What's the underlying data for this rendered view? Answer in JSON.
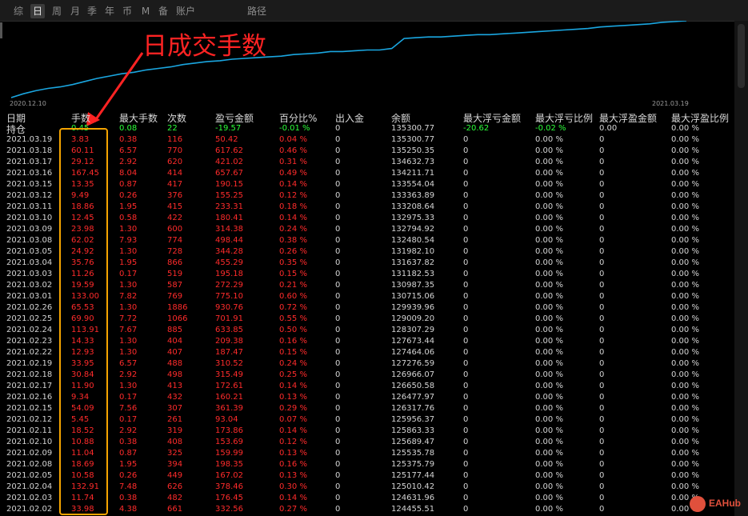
{
  "toolbar": {
    "tabs": [
      {
        "label": "综",
        "active": false
      },
      {
        "label": "日",
        "active": true
      },
      {
        "label": "周",
        "active": false
      },
      {
        "label": "月",
        "active": false
      },
      {
        "label": "季",
        "active": false
      },
      {
        "label": "年",
        "active": false
      },
      {
        "label": "币",
        "active": false
      },
      {
        "label": "M",
        "active": false
      },
      {
        "label": "备",
        "active": false
      },
      {
        "label": "账户",
        "active": false
      },
      {
        "label": "路径",
        "active": false
      }
    ]
  },
  "chart": {
    "start_date": "2020.12.10",
    "end_date": "2021.03.19",
    "line_color": "#1aa6e0"
  },
  "chart_data": {
    "type": "line",
    "x_start": "2020.12.10",
    "x_end": "2021.03.19",
    "series": [
      {
        "values": [
          0.0,
          0.05,
          0.09,
          0.12,
          0.14,
          0.17,
          0.21,
          0.25,
          0.28,
          0.31,
          0.33,
          0.36,
          0.38,
          0.4,
          0.43,
          0.45,
          0.47,
          0.48,
          0.5,
          0.51,
          0.52,
          0.53,
          0.54,
          0.56,
          0.57,
          0.58,
          0.6,
          0.6,
          0.61,
          0.62,
          0.62,
          0.64,
          0.77,
          0.78,
          0.79,
          0.79,
          0.8,
          0.81,
          0.82,
          0.82,
          0.83,
          0.84,
          0.85,
          0.86,
          0.87,
          0.88,
          0.89,
          0.9,
          0.92,
          0.93,
          0.94,
          0.95,
          0.96,
          0.98,
          0.99,
          1.0
        ]
      }
    ],
    "grid": false,
    "legend": "none"
  },
  "annotation": {
    "text": "日成交手数",
    "color": "#ff2323",
    "box_color": "#f5a400"
  },
  "table": {
    "headers": [
      "日期",
      "手数",
      "最大手数",
      "次数",
      "盈亏金额",
      "百分比%",
      "出入金",
      "余额",
      "最大浮亏金额",
      "最大浮亏比例",
      "最大浮盈金额",
      "最大浮盈比例"
    ],
    "holding": [
      "持仓",
      "0.45",
      "0.08",
      "22",
      "-19.57",
      "-0.01 %",
      "0",
      "135300.77",
      "-20.62",
      "-0.02 %",
      "0.00",
      "0.00 %"
    ],
    "rows": [
      [
        "2021.03.19",
        "3.83",
        "0.38",
        "116",
        "50.42",
        "0.04 %",
        "0",
        "135300.77",
        "0",
        "0.00 %",
        "0",
        "0.00 %"
      ],
      [
        "2021.03.18",
        "60.11",
        "6.57",
        "770",
        "617.62",
        "0.46 %",
        "0",
        "135250.35",
        "0",
        "0.00 %",
        "0",
        "0.00 %"
      ],
      [
        "2021.03.17",
        "29.12",
        "2.92",
        "620",
        "421.02",
        "0.31 %",
        "0",
        "134632.73",
        "0",
        "0.00 %",
        "0",
        "0.00 %"
      ],
      [
        "2021.03.16",
        "167.45",
        "8.04",
        "414",
        "657.67",
        "0.49 %",
        "0",
        "134211.71",
        "0",
        "0.00 %",
        "0",
        "0.00 %"
      ],
      [
        "2021.03.15",
        "13.35",
        "0.87",
        "417",
        "190.15",
        "0.14 %",
        "0",
        "133554.04",
        "0",
        "0.00 %",
        "0",
        "0.00 %"
      ],
      [
        "2021.03.12",
        "9.49",
        "0.26",
        "376",
        "155.25",
        "0.12 %",
        "0",
        "133363.89",
        "0",
        "0.00 %",
        "0",
        "0.00 %"
      ],
      [
        "2021.03.11",
        "18.86",
        "1.95",
        "415",
        "233.31",
        "0.18 %",
        "0",
        "133208.64",
        "0",
        "0.00 %",
        "0",
        "0.00 %"
      ],
      [
        "2021.03.10",
        "12.45",
        "0.58",
        "422",
        "180.41",
        "0.14 %",
        "0",
        "132975.33",
        "0",
        "0.00 %",
        "0",
        "0.00 %"
      ],
      [
        "2021.03.09",
        "23.98",
        "1.30",
        "600",
        "314.38",
        "0.24 %",
        "0",
        "132794.92",
        "0",
        "0.00 %",
        "0",
        "0.00 %"
      ],
      [
        "2021.03.08",
        "62.02",
        "7.93",
        "774",
        "498.44",
        "0.38 %",
        "0",
        "132480.54",
        "0",
        "0.00 %",
        "0",
        "0.00 %"
      ],
      [
        "2021.03.05",
        "24.92",
        "1.30",
        "728",
        "344.28",
        "0.26 %",
        "0",
        "131982.10",
        "0",
        "0.00 %",
        "0",
        "0.00 %"
      ],
      [
        "2021.03.04",
        "35.76",
        "1.95",
        "866",
        "455.29",
        "0.35 %",
        "0",
        "131637.82",
        "0",
        "0.00 %",
        "0",
        "0.00 %"
      ],
      [
        "2021.03.03",
        "11.26",
        "0.17",
        "519",
        "195.18",
        "0.15 %",
        "0",
        "131182.53",
        "0",
        "0.00 %",
        "0",
        "0.00 %"
      ],
      [
        "2021.03.02",
        "19.59",
        "1.30",
        "587",
        "272.29",
        "0.21 %",
        "0",
        "130987.35",
        "0",
        "0.00 %",
        "0",
        "0.00 %"
      ],
      [
        "2021.03.01",
        "133.00",
        "7.82",
        "769",
        "775.10",
        "0.60 %",
        "0",
        "130715.06",
        "0",
        "0.00 %",
        "0",
        "0.00 %"
      ],
      [
        "2021.02.26",
        "65.53",
        "1.30",
        "1886",
        "930.76",
        "0.72 %",
        "0",
        "129939.96",
        "0",
        "0.00 %",
        "0",
        "0.00 %"
      ],
      [
        "2021.02.25",
        "69.90",
        "7.72",
        "1066",
        "701.91",
        "0.55 %",
        "0",
        "129009.20",
        "0",
        "0.00 %",
        "0",
        "0.00 %"
      ],
      [
        "2021.02.24",
        "113.91",
        "7.67",
        "885",
        "633.85",
        "0.50 %",
        "0",
        "128307.29",
        "0",
        "0.00 %",
        "0",
        "0.00 %"
      ],
      [
        "2021.02.23",
        "14.33",
        "1.30",
        "404",
        "209.38",
        "0.16 %",
        "0",
        "127673.44",
        "0",
        "0.00 %",
        "0",
        "0.00 %"
      ],
      [
        "2021.02.22",
        "12.93",
        "1.30",
        "407",
        "187.47",
        "0.15 %",
        "0",
        "127464.06",
        "0",
        "0.00 %",
        "0",
        "0.00 %"
      ],
      [
        "2021.02.19",
        "33.95",
        "6.57",
        "488",
        "310.52",
        "0.24 %",
        "0",
        "127276.59",
        "0",
        "0.00 %",
        "0",
        "0.00 %"
      ],
      [
        "2021.02.18",
        "30.84",
        "2.92",
        "498",
        "315.49",
        "0.25 %",
        "0",
        "126966.07",
        "0",
        "0.00 %",
        "0",
        "0.00 %"
      ],
      [
        "2021.02.17",
        "11.90",
        "1.30",
        "413",
        "172.61",
        "0.14 %",
        "0",
        "126650.58",
        "0",
        "0.00 %",
        "0",
        "0.00 %"
      ],
      [
        "2021.02.16",
        "9.34",
        "0.17",
        "432",
        "160.21",
        "0.13 %",
        "0",
        "126477.97",
        "0",
        "0.00 %",
        "0",
        "0.00 %"
      ],
      [
        "2021.02.15",
        "54.09",
        "7.56",
        "307",
        "361.39",
        "0.29 %",
        "0",
        "126317.76",
        "0",
        "0.00 %",
        "0",
        "0.00 %"
      ],
      [
        "2021.02.12",
        "5.45",
        "0.17",
        "261",
        "93.04",
        "0.07 %",
        "0",
        "125956.37",
        "0",
        "0.00 %",
        "0",
        "0.00 %"
      ],
      [
        "2021.02.11",
        "18.52",
        "2.92",
        "319",
        "173.86",
        "0.14 %",
        "0",
        "125863.33",
        "0",
        "0.00 %",
        "0",
        "0.00 %"
      ],
      [
        "2021.02.10",
        "10.88",
        "0.38",
        "408",
        "153.69",
        "0.12 %",
        "0",
        "125689.47",
        "0",
        "0.00 %",
        "0",
        "0.00 %"
      ],
      [
        "2021.02.09",
        "11.04",
        "0.87",
        "325",
        "159.99",
        "0.13 %",
        "0",
        "125535.78",
        "0",
        "0.00 %",
        "0",
        "0.00 %"
      ],
      [
        "2021.02.08",
        "18.69",
        "1.95",
        "394",
        "198.35",
        "0.16 %",
        "0",
        "125375.79",
        "0",
        "0.00 %",
        "0",
        "0.00 %"
      ],
      [
        "2021.02.05",
        "10.58",
        "0.26",
        "449",
        "167.02",
        "0.13 %",
        "0",
        "125177.44",
        "0",
        "0.00 %",
        "0",
        "0.00 %"
      ],
      [
        "2021.02.04",
        "132.91",
        "7.48",
        "626",
        "378.46",
        "0.30 %",
        "0",
        "125010.42",
        "0",
        "0.00 %",
        "0",
        "0.00 %"
      ],
      [
        "2021.02.03",
        "11.74",
        "0.38",
        "482",
        "176.45",
        "0.14 %",
        "0",
        "124631.96",
        "0",
        "0.00 %",
        "0",
        "0.00 %"
      ],
      [
        "2021.02.02",
        "33.98",
        "4.38",
        "661",
        "332.56",
        "0.27 %",
        "0",
        "124455.51",
        "0",
        "0.00 %",
        "0",
        "0.00 %"
      ]
    ]
  },
  "watermark": {
    "text": "EAHub"
  },
  "colors": {
    "profit_red": "#ff2b2b",
    "holding_green": "#2dff3a",
    "neutral_text": "#d4d4d4",
    "background": "#000000"
  }
}
